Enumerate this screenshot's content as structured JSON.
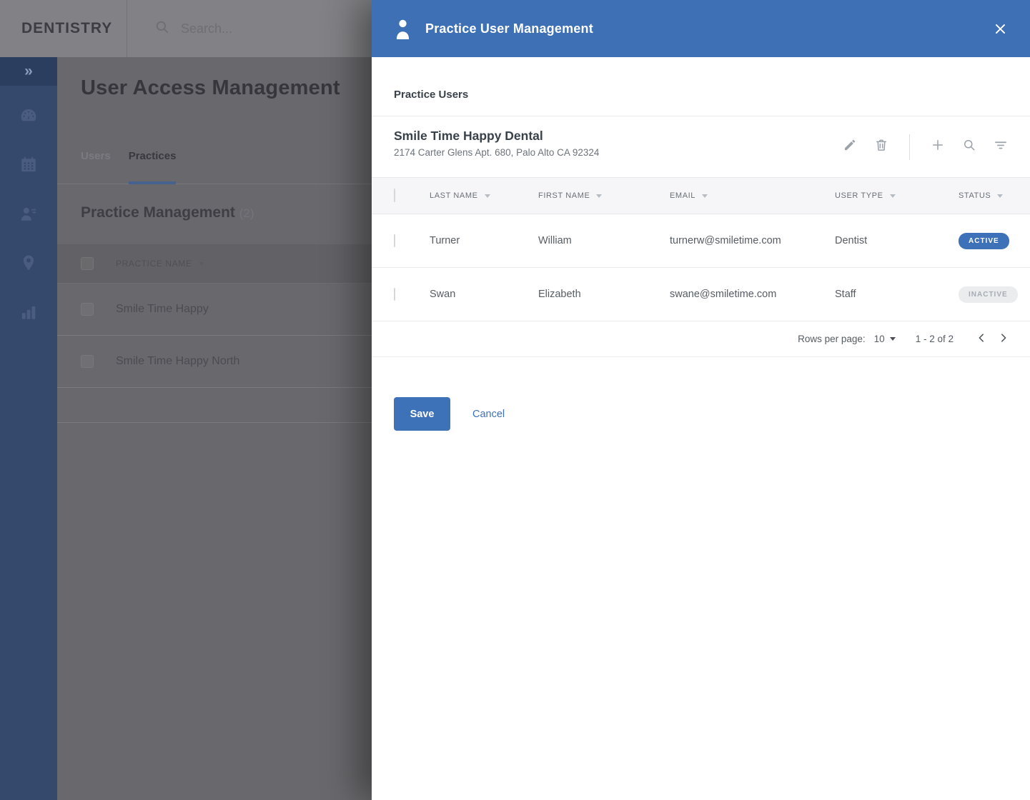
{
  "background": {
    "logo": "DENTISTRY",
    "search_placeholder": "Search...",
    "page_title": "User Access Management",
    "tabs": [
      {
        "label": "Users",
        "active": false
      },
      {
        "label": "Practices",
        "active": true
      }
    ],
    "section_title": "Practice Management",
    "section_count": "(2)",
    "practice_table": {
      "header": "PRACTICE NAME",
      "rows": [
        "Smile Time Happy",
        "Smile Time Happy North"
      ]
    },
    "sidebar_icons": [
      "expand",
      "dashboard",
      "calendar",
      "user-management",
      "locations",
      "reports"
    ]
  },
  "modal": {
    "title": "Practice User Management",
    "section_label": "Practice Users",
    "practice": {
      "name": "Smile Time Happy Dental",
      "address": "2174 Carter Glens Apt. 680, Palo Alto CA 92324"
    },
    "toolbar_icons": [
      "edit",
      "delete",
      "add",
      "search",
      "filter"
    ],
    "table": {
      "columns": [
        "LAST NAME",
        "FIRST NAME",
        "EMAIL",
        "USER TYPE",
        "STATUS"
      ],
      "rows": [
        {
          "last": "Turner",
          "first": "William",
          "email": "turnerw@smiletime.com",
          "type": "Dentist",
          "status": "ACTIVE",
          "status_active": true
        },
        {
          "last": "Swan",
          "first": "Elizabeth",
          "email": "swane@smiletime.com",
          "type": "Staff",
          "status": "INACTIVE",
          "status_active": false
        }
      ]
    },
    "pagination": {
      "rows_per_page_label": "Rows per page:",
      "rows_per_page": "10",
      "range": "1 - 2 of 2"
    },
    "actions": {
      "save": "Save",
      "cancel": "Cancel"
    }
  },
  "colors": {
    "accent": "#3d72b8",
    "modal_header_blue": "#3e70b5",
    "active_badge_bg": "#3d72b8",
    "inactive_badge_bg": "#ebecee",
    "sidebar_navy": "#35496d"
  }
}
